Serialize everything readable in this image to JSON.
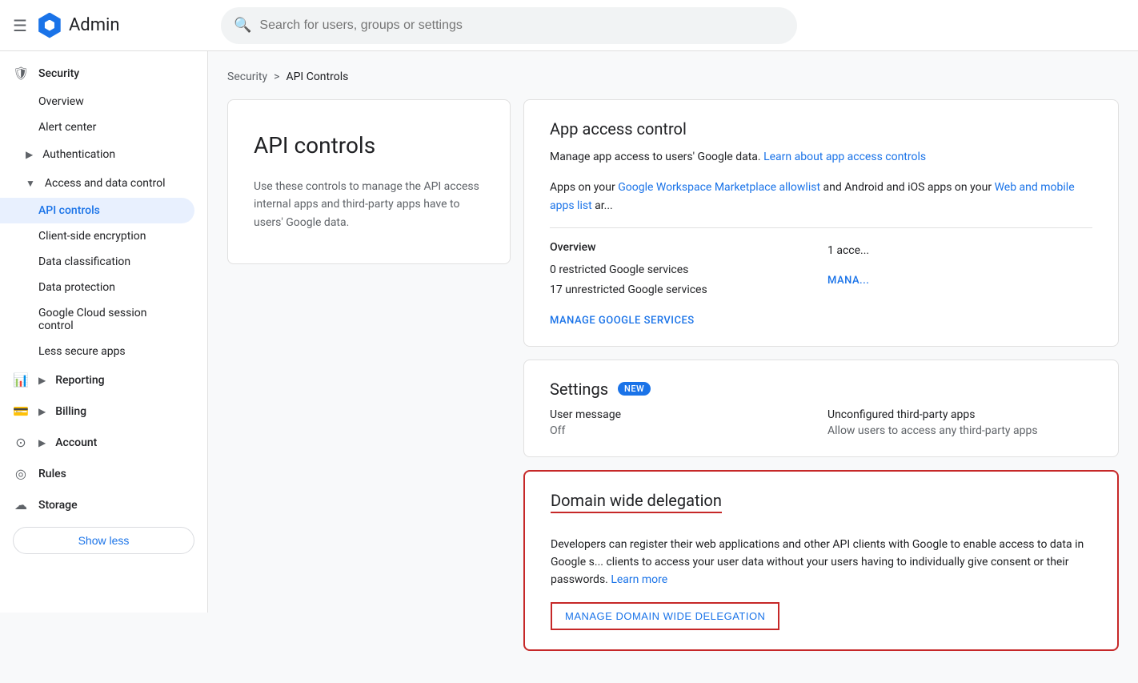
{
  "topbar": {
    "menu_icon": "☰",
    "app_title": "Admin",
    "search_placeholder": "Search for users, groups or settings"
  },
  "breadcrumb": {
    "parent": "Security",
    "separator": ">",
    "current": "API Controls"
  },
  "sidebar": {
    "security_label": "Security",
    "overview_label": "Overview",
    "alert_center_label": "Alert center",
    "authentication_label": "Authentication",
    "access_data_control_label": "Access and data control",
    "api_controls_label": "API controls",
    "client_side_encryption_label": "Client-side encryption",
    "data_classification_label": "Data classification",
    "data_protection_label": "Data protection",
    "google_cloud_label": "Google Cloud session control",
    "less_secure_label": "Less secure apps",
    "reporting_label": "Reporting",
    "billing_label": "Billing",
    "account_label": "Account",
    "rules_label": "Rules",
    "storage_label": "Storage",
    "show_less_label": "Show less"
  },
  "info_card": {
    "title": "API controls",
    "description": "Use these controls to manage the API access internal apps and third-party apps have to users' Google data."
  },
  "app_access_panel": {
    "title": "App access control",
    "description_start": "Manage app access to users' Google data.",
    "learn_link": "Learn about app access controls",
    "description_mid": "Apps on your",
    "marketplace_link": "Google Workspace Marketplace allowlist",
    "description_mid2": "and Android and iOS apps on your",
    "mobile_link": "Web and mobile apps list",
    "description_end": "ar...",
    "overview_label": "Overview",
    "stat1": "0 restricted Google services",
    "stat2": "17 unrestricted Google services",
    "stat3": "1 acce...",
    "manage_services_link": "MANAGE GOOGLE SERVICES",
    "manage_right_link": "MANA..."
  },
  "settings_panel": {
    "title": "Settings",
    "badge": "NEW",
    "user_message_label": "User message",
    "user_message_value": "Off",
    "unconfigured_label": "Unconfigured third-party apps",
    "unconfigured_value": "Allow users to access any third-party apps"
  },
  "domain_delegation_panel": {
    "title": "Domain wide delegation",
    "description": "Developers can register their web applications and other API clients with Google to enable access to data in Google s... clients to access your user data without your users having to individually give consent or their passwords.",
    "learn_more_link": "Learn more",
    "manage_btn": "MANAGE DOMAIN WIDE DELEGATION"
  }
}
